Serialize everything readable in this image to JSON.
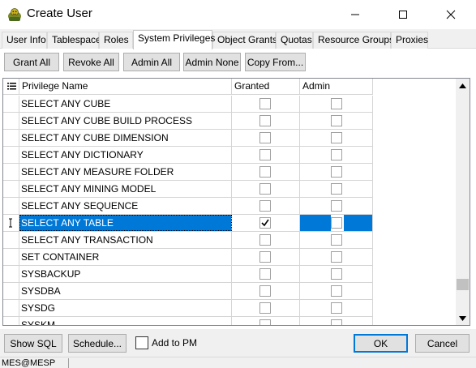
{
  "window": {
    "title": "Create User",
    "icon": "user-add-icon"
  },
  "tabs": [
    {
      "label": "User Info",
      "active": false
    },
    {
      "label": "Tablespace",
      "active": false
    },
    {
      "label": "Roles",
      "active": false
    },
    {
      "label": "System Privileges",
      "active": true
    },
    {
      "label": "Object Grants",
      "active": false
    },
    {
      "label": "Quotas",
      "active": false
    },
    {
      "label": "Resource Groups",
      "active": false
    },
    {
      "label": "Proxies",
      "active": false
    }
  ],
  "toolbar": {
    "grant_all": "Grant All",
    "revoke_all": "Revoke All",
    "admin_all": "Admin All",
    "admin_none": "Admin None",
    "copy_from": "Copy From..."
  },
  "grid": {
    "columns": {
      "name": "Privilege Name",
      "granted": "Granted",
      "admin": "Admin"
    },
    "rows": [
      {
        "name": "SELECT ANY CUBE",
        "granted": false,
        "admin": false
      },
      {
        "name": "SELECT ANY CUBE BUILD PROCESS",
        "granted": false,
        "admin": false
      },
      {
        "name": "SELECT ANY CUBE DIMENSION",
        "granted": false,
        "admin": false
      },
      {
        "name": "SELECT ANY DICTIONARY",
        "granted": false,
        "admin": false
      },
      {
        "name": "SELECT ANY MEASURE FOLDER",
        "granted": false,
        "admin": false
      },
      {
        "name": "SELECT ANY MINING MODEL",
        "granted": false,
        "admin": false
      },
      {
        "name": "SELECT ANY SEQUENCE",
        "granted": false,
        "admin": false
      },
      {
        "name": "SELECT ANY TABLE",
        "granted": true,
        "admin": false,
        "selected": true
      },
      {
        "name": "SELECT ANY TRANSACTION",
        "granted": false,
        "admin": false
      },
      {
        "name": "SET CONTAINER",
        "granted": false,
        "admin": false
      },
      {
        "name": "SYSBACKUP",
        "granted": false,
        "admin": false
      },
      {
        "name": "SYSDBA",
        "granted": false,
        "admin": false
      },
      {
        "name": "SYSDG",
        "granted": false,
        "admin": false
      },
      {
        "name": "SYSKM",
        "granted": false,
        "admin": false
      }
    ],
    "scroll_position_fraction": 0.9
  },
  "footer": {
    "show_sql": "Show SQL",
    "schedule": "Schedule...",
    "add_to_pm": "Add to PM",
    "add_to_pm_checked": false,
    "ok": "OK",
    "cancel": "Cancel"
  },
  "status": {
    "connection": "MES@MESP"
  },
  "colors": {
    "selection": "#0078d7",
    "ok_border": "#0078d7"
  }
}
